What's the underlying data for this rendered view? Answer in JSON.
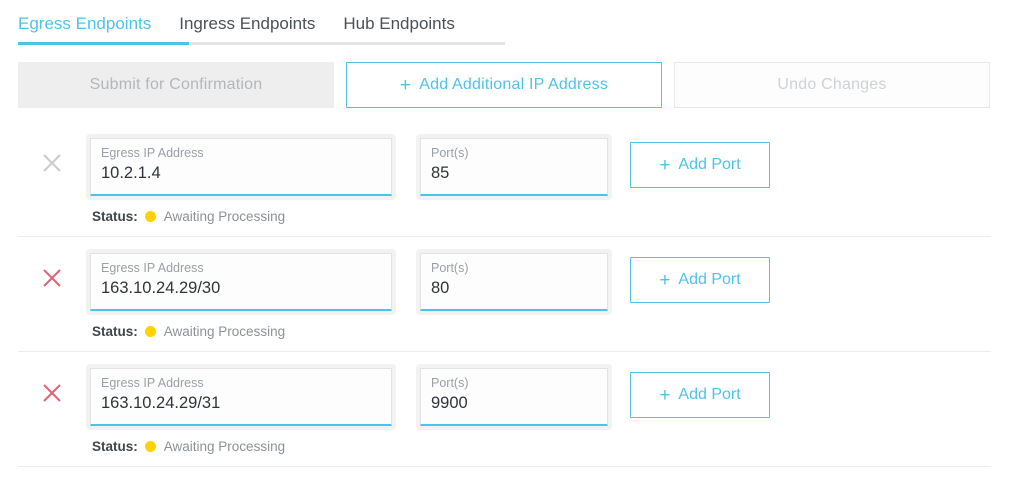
{
  "tabs": [
    {
      "label": "Egress Endpoints",
      "active": true
    },
    {
      "label": "Ingress Endpoints",
      "active": false
    },
    {
      "label": "Hub Endpoints",
      "active": false
    }
  ],
  "toolbar": {
    "submit_label": "Submit for Confirmation",
    "add_ip_label": "Add Additional IP Address",
    "add_ip_plus": "+",
    "undo_label": "Undo Changes"
  },
  "labels": {
    "ip_field_label": "Egress IP Address",
    "port_field_label": "Port(s)",
    "status_label": "Status:",
    "add_port_label": "Add Port",
    "add_port_plus": "+",
    "remove_icon": "close-x-icon"
  },
  "colors": {
    "accent": "#4ec3e8",
    "status_dot": "#ffd200",
    "remove_active": "#e06377",
    "remove_disabled": "#cccccc",
    "disabled_bg": "#eeeeee",
    "disabled_text": "#b4b7ba"
  },
  "rows": [
    {
      "ip": "10.2.1.4",
      "port": "85",
      "status": "Awaiting Processing",
      "remove_enabled": false
    },
    {
      "ip": "163.10.24.29/30",
      "port": "80",
      "status": "Awaiting Processing",
      "remove_enabled": true
    },
    {
      "ip": "163.10.24.29/31",
      "port": "9900",
      "status": "Awaiting Processing",
      "remove_enabled": true
    }
  ]
}
